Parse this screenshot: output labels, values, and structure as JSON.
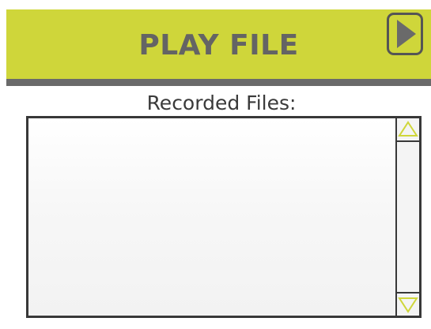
{
  "header": {
    "title": "PLAY FILE",
    "play_icon": "play-icon"
  },
  "files": {
    "label": "Recorded Files:",
    "items": [],
    "scroll_up_icon": "triangle-up-icon",
    "scroll_down_icon": "triangle-down-icon"
  },
  "colors": {
    "header_bg": "#cfd63a",
    "header_rule": "#6a6a6a",
    "title_text": "#646464",
    "scroll_arrow": "#cfd63a",
    "border": "#383838"
  }
}
